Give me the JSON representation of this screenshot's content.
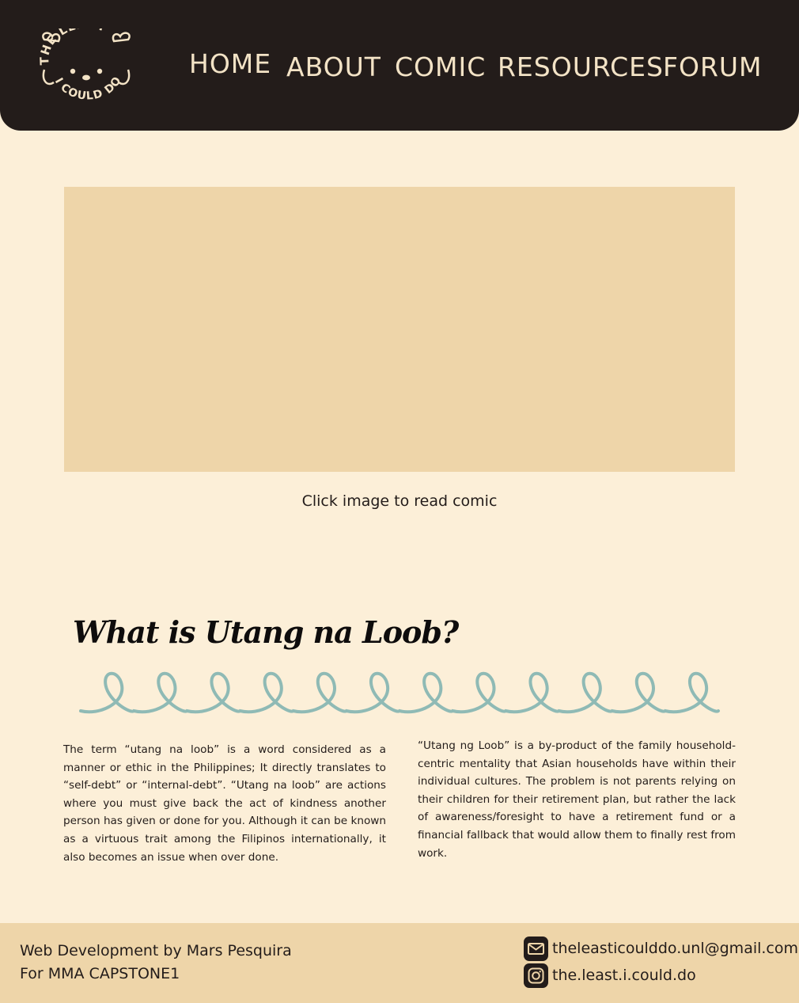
{
  "header": {
    "logo_text_top": "THE LEAST",
    "logo_text_bottom": "I COULD DO",
    "nav": [
      {
        "label": "HOME"
      },
      {
        "label": "ABOUT"
      },
      {
        "label": "COMIC"
      },
      {
        "label": "RESOURCES"
      },
      {
        "label": "FORUM"
      }
    ]
  },
  "comic": {
    "caption": "Click image to read comic"
  },
  "section": {
    "title": "What is Utang na Loob?",
    "paragraph_left": " The term “utang na loob” is a word considered as a manner or ethic in the Philippines; It directly translates to “self-debt” or “internal-debt”. “Utang na loob” are actions where you must give back the act of kindness another person has given or done for you. Although it can be known as a virtuous trait among the Filipinos internationally, it also becomes an issue when over done.",
    "paragraph_right": "“Utang ng Loob” is a by-product of the family household-centric mentality that Asian households have within their individual cultures. The problem is not parents relying on their children for their retirement plan, but rather the lack of awareness/foresight to have a retirement fund or a financial fallback that would allow them to finally rest from work."
  },
  "footer": {
    "credit_line1": "Web Development by Mars Pesquira",
    "credit_line2": "For MMA CAPSTONE1",
    "email": "theleasticoulddo.unl@gmail.com",
    "instagram": "the.least.i.could.do"
  },
  "colors": {
    "background": "#fcefd8",
    "header_bg": "#231c1a",
    "nav_text": "#f3e3c6",
    "placeholder": "#eed5a9",
    "squiggle": "#8fbab5"
  }
}
